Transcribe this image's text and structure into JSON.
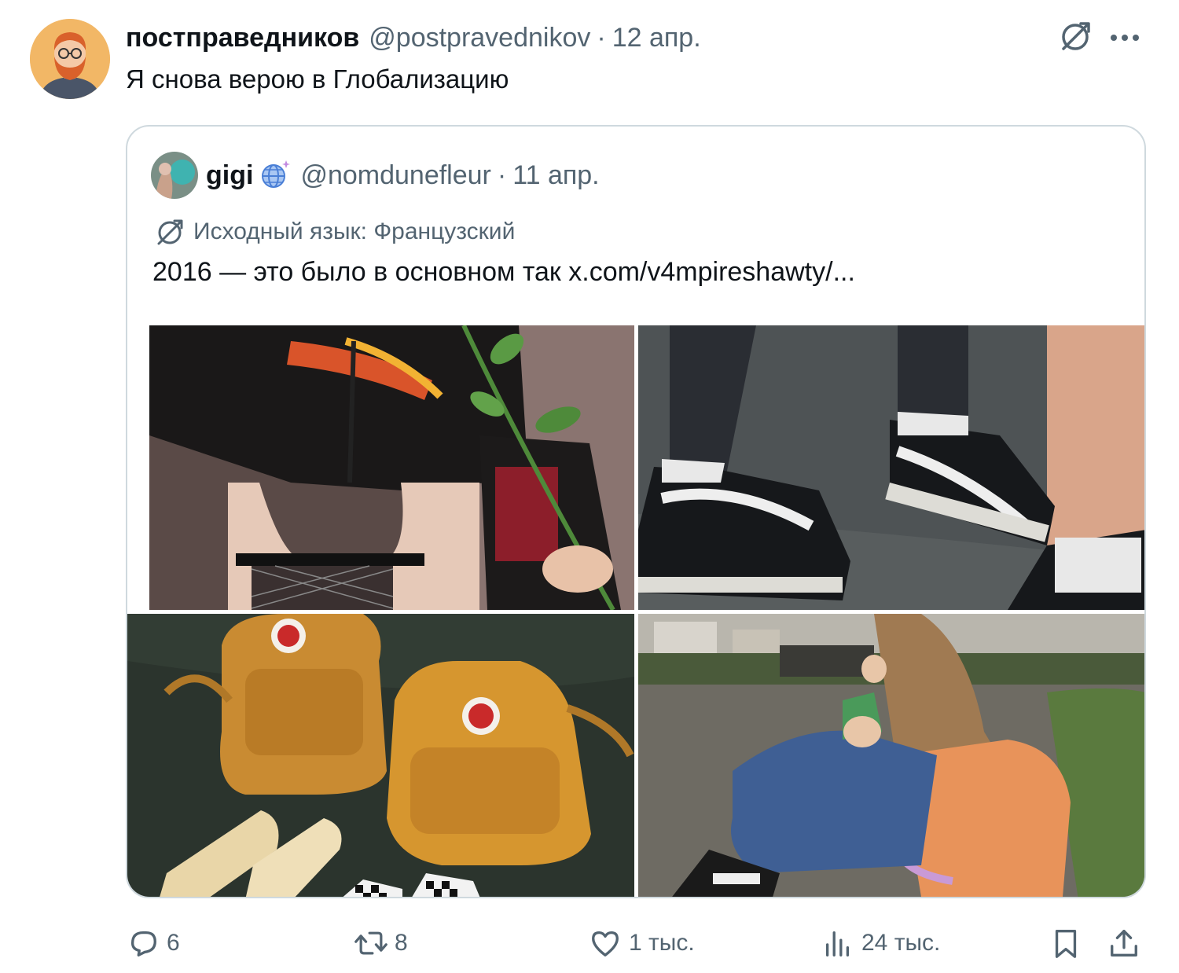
{
  "post": {
    "display_name": "постправедников",
    "handle": "@postpravednikov",
    "separator": "·",
    "date": "12 апр.",
    "text": "Я снова верою в Глобализацию",
    "avatar_icon": "bearded-man-avatar-icon",
    "translate_icon": "translate-icon",
    "more_icon": "more-dots-icon"
  },
  "quote": {
    "display_name": "gigi",
    "badge_icon": "globe-sparkle-icon",
    "handle": "@nomdunefleur",
    "separator": "·",
    "date": "11 апр.",
    "translated_label": "Исходный язык: Французский",
    "text": "2016 — это было в основном так x.com/v4mpireshawty/...",
    "media": [
      {
        "name": "photo-thrasher-shirt-with-rose"
      },
      {
        "name": "photo-vans-old-skool-sneakers"
      },
      {
        "name": "photo-yellow-kanken-backpacks"
      },
      {
        "name": "photo-girl-sitting-on-court"
      }
    ]
  },
  "actions": {
    "replies": "6",
    "reposts": "8",
    "likes": "1 тыс.",
    "views": "24 тыс."
  },
  "colors": {
    "text_primary": "#0f1419",
    "text_secondary": "#536471",
    "border": "#cfd9de",
    "avatar_bg": "#f2b766"
  }
}
